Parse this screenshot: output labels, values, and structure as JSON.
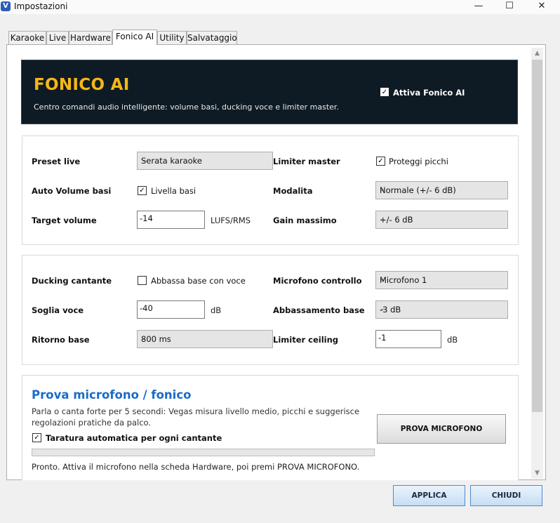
{
  "window": {
    "title": "Impostazioni",
    "icon_letter": "V",
    "controls": {
      "minimize": "—",
      "maximize": "☐",
      "close": "✕"
    }
  },
  "tabs": [
    {
      "label": "Karaoke",
      "active": false
    },
    {
      "label": "Live",
      "active": false
    },
    {
      "label": "Hardware",
      "active": false
    },
    {
      "label": "Fonico AI",
      "active": true
    },
    {
      "label": "Utility",
      "active": false
    },
    {
      "label": "Salvataggio",
      "active": false
    }
  ],
  "header": {
    "title": "FONICO AI",
    "subtitle": "Centro comandi audio intelligente: volume basi, ducking voce e limiter master.",
    "enable_label": "Attiva Fonico AI",
    "enable_checked": true
  },
  "group1": {
    "preset_label": "Preset live",
    "preset_value": "Serata karaoke",
    "auto_volume_label": "Auto Volume basi",
    "auto_volume_check_label": "Livella basi",
    "auto_volume_checked": true,
    "target_label": "Target volume",
    "target_value": "-14",
    "target_unit": "LUFS/RMS",
    "limiter_label": "Limiter master",
    "limiter_check_label": "Proteggi picchi",
    "limiter_checked": true,
    "modalita_label": "Modalita",
    "modalita_value": "Normale (+/- 6 dB)",
    "gain_label": "Gain massimo",
    "gain_value": "+/- 6 dB"
  },
  "group2": {
    "ducking_label": "Ducking cantante",
    "ducking_check_label": "Abbassa base con voce",
    "ducking_checked": false,
    "soglia_label": "Soglia voce",
    "soglia_value": "-40",
    "soglia_unit": "dB",
    "ritorno_label": "Ritorno base",
    "ritorno_value": "800 ms",
    "mic_label": "Microfono controllo",
    "mic_value": "Microfono 1",
    "abbass_label": "Abbassamento base",
    "abbass_value": "-3 dB",
    "ceiling_label": "Limiter ceiling",
    "ceiling_value": "-1",
    "ceiling_unit": "dB"
  },
  "prova": {
    "title": "Prova microfono / fonico",
    "description": "Parla o canta forte per 5 secondi: Vegas misura livello medio, picchi e suggerisce regolazioni pratiche da palco.",
    "auto_label": "Taratura automatica per ogni cantante",
    "auto_checked": true,
    "button": "PROVA MICROFONO",
    "progress": 0,
    "status": "Pronto. Attiva il microfono nella scheda Hardware, poi premi PROVA MICROFONO."
  },
  "footer": {
    "apply": "APPLICA",
    "close": "CHIUDI"
  },
  "icons": {
    "check": "✓",
    "combo_arrow": "⌄",
    "scroll_up": "▲",
    "scroll_down": "▼"
  }
}
